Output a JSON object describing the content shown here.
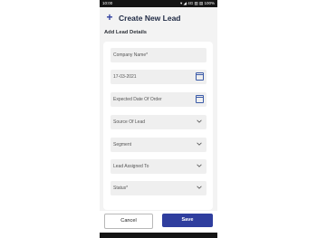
{
  "status_bar": {
    "time": "10:00",
    "right_text": "▾ ◢ 4G ▥ ▤ 100%"
  },
  "header": {
    "title": "Create New Lead",
    "icon": "plus-icon"
  },
  "section_title": "Add Lead Details",
  "form": {
    "fields": [
      {
        "label": "Company Name*",
        "icon": null
      },
      {
        "label": "17-03-2021",
        "icon": "calendar-icon"
      },
      {
        "label": "Expected Date Of Order",
        "icon": "calendar-icon"
      },
      {
        "label": "Source Of Lead",
        "icon": "chevron-down-icon"
      },
      {
        "label": "Segment",
        "icon": "chevron-down-icon"
      },
      {
        "label": "Lead Assigned To",
        "icon": "chevron-down-icon"
      },
      {
        "label": "Status*",
        "icon": "chevron-down-icon"
      }
    ]
  },
  "buttons": {
    "cancel": "Cancel",
    "save": "Save"
  },
  "colors": {
    "primary": "#2f3e9e",
    "background": "#f3f3f3",
    "card": "#ffffff",
    "field": "#efefef"
  }
}
